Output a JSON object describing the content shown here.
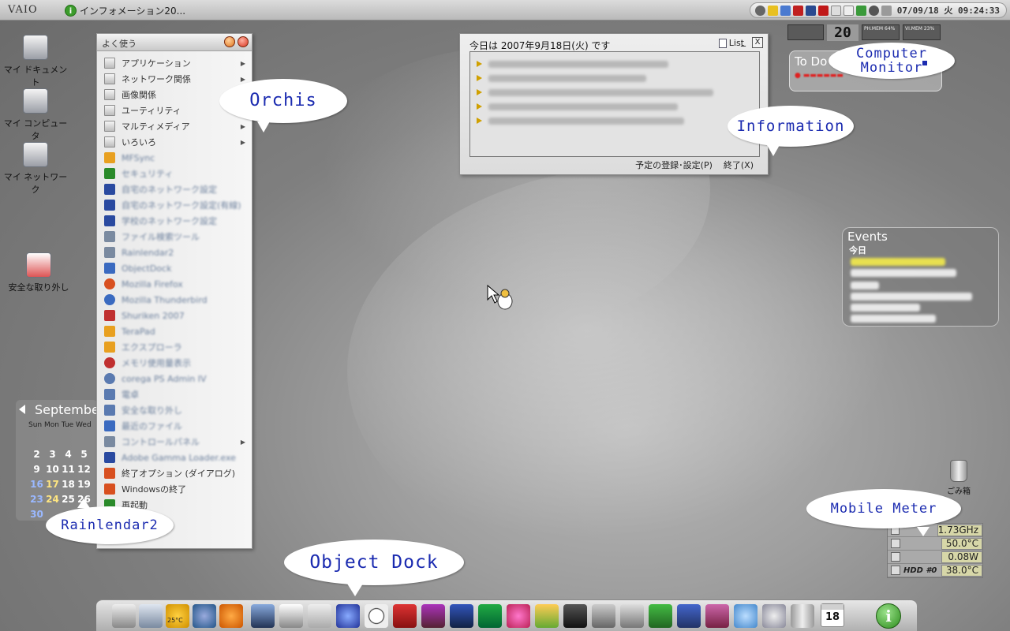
{
  "topbar": {
    "logo": "VAIO",
    "task_label": "インフォメーション20...",
    "clock": "07/09/18 火 09:24:33"
  },
  "desktop_icons": [
    {
      "label": "マイ ドキュメント"
    },
    {
      "label": "マイ コンピュータ"
    },
    {
      "label": "マイ ネットワーク"
    },
    {
      "label": "安全な取り外し"
    }
  ],
  "orchis": {
    "title": "よく使う",
    "items": [
      {
        "label": "アプリケーション",
        "submenu": true
      },
      {
        "label": "ネットワーク関係",
        "submenu": true
      },
      {
        "label": "画像関係",
        "submenu": false
      },
      {
        "label": "ユーティリティ",
        "submenu": true
      },
      {
        "label": "マルティメディア",
        "submenu": true
      },
      {
        "label": "いろいろ",
        "submenu": true
      },
      {
        "label": "MFSync"
      },
      {
        "label": "セキュリティ"
      },
      {
        "label": "自宅のネットワーク設定"
      },
      {
        "label": "自宅のネットワーク設定(有線)"
      },
      {
        "label": "学校のネットワーク設定"
      },
      {
        "label": "ファイル検索ツール"
      },
      {
        "label": "Rainlendar2"
      },
      {
        "label": "ObjectDock"
      },
      {
        "label": "Mozilla Firefox"
      },
      {
        "label": "Mozilla Thunderbird"
      },
      {
        "label": "Shuriken 2007"
      },
      {
        "label": "TeraPad"
      },
      {
        "label": "エクスプローラ"
      },
      {
        "label": "メモリ使用量表示"
      },
      {
        "label": "corega PS Admin IV"
      },
      {
        "label": "電卓"
      },
      {
        "label": "安全な取り外し"
      },
      {
        "label": "最近のファイル"
      },
      {
        "label": "コントロールパネル"
      },
      {
        "label": "Adobe Gamma Loader.exe"
      },
      {
        "label": "終了オプション (ダイアログ)"
      },
      {
        "label": "Windowsの終了"
      },
      {
        "label": "再起動"
      }
    ]
  },
  "info_window": {
    "title": "今日は 2007年9月18日(火) です",
    "list_label": "List",
    "min_label": "_",
    "close_label": "X",
    "footer_schedule": "予定の登録･設定(P)",
    "footer_exit": "終了(X)"
  },
  "computer_monitor": {
    "cpu_value": "20",
    "ph_mem_label": "PH.MEM",
    "ph_mem_pct": "64%",
    "vi_mem_label": "VI.MEM",
    "vi_mem_pct": "23%"
  },
  "todo": {
    "title": "To Do"
  },
  "events": {
    "title": "Events",
    "today": "今日"
  },
  "calendar": {
    "month": "September",
    "dow": "Sun Mon Tue Wed",
    "rows": [
      [
        "2",
        "3",
        "4",
        "5"
      ],
      [
        "9",
        "10",
        "11",
        "12"
      ],
      [
        "16",
        "17",
        "18",
        "19"
      ],
      [
        "23",
        "24",
        "25",
        "26"
      ],
      [
        "30",
        "",
        "",
        ""
      ]
    ]
  },
  "mobile_meter": {
    "rows": [
      {
        "label": "",
        "value": "1.73GHz"
      },
      {
        "label": "",
        "value": "50.0°C"
      },
      {
        "label": "",
        "value": "0.08W"
      },
      {
        "label": "HDD #0",
        "value": "38.0°C"
      }
    ]
  },
  "trash": {
    "label": "ごみ箱"
  },
  "dock": {
    "calendar_day": "18",
    "weather_temp": "25°C"
  },
  "callouts": {
    "orchis": "Orchis",
    "information": "Information",
    "computer_monitor": "Computer Monitor",
    "rainlendar": "Rainlendar2",
    "mobile_meter": "Mobile Meter",
    "object_dock": "Object Dock"
  },
  "colors": {
    "info_accent": "#3c9c2c",
    "callout_text": "#1b2bb0",
    "meter_bg": "#d7d7a8"
  }
}
